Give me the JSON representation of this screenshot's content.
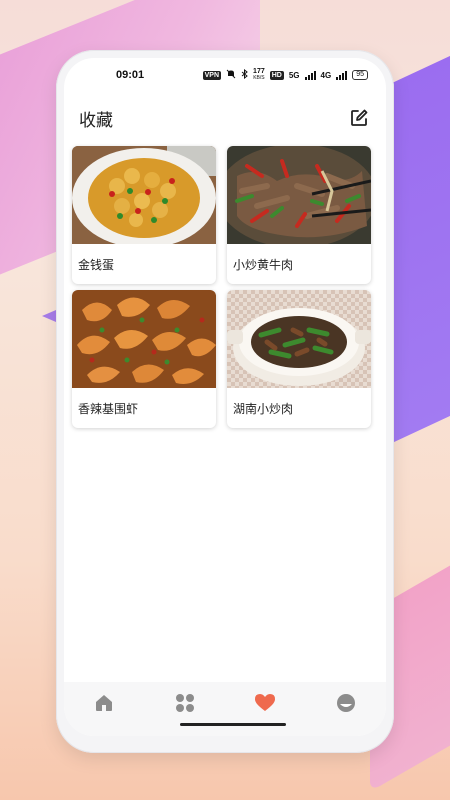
{
  "status_bar": {
    "time": "09:01",
    "vpn": "VPN",
    "speed_value": "177",
    "speed_unit": "KB/S",
    "hd": "HD",
    "net1": "5G",
    "net2": "4G",
    "battery": "95"
  },
  "header": {
    "title": "收藏",
    "edit_icon": "edit-icon"
  },
  "favorites": [
    {
      "name": "金钱蛋",
      "image_icon": "golden-egg-dish"
    },
    {
      "name": "小炒黄牛肉",
      "image_icon": "stir-fried-beef-dish"
    },
    {
      "name": "香辣基围虾",
      "image_icon": "spicy-shrimp-dish"
    },
    {
      "name": "湖南小炒肉",
      "image_icon": "hunan-pork-dish"
    }
  ],
  "tab_bar": {
    "tabs": [
      {
        "icon": "home-icon",
        "active": false
      },
      {
        "icon": "grid-icon",
        "active": false
      },
      {
        "icon": "heart-icon",
        "active": true
      },
      {
        "icon": "profile-icon",
        "active": false
      }
    ],
    "inactive_color": "#8c8c8c",
    "active_color": "#ef6a4e"
  }
}
